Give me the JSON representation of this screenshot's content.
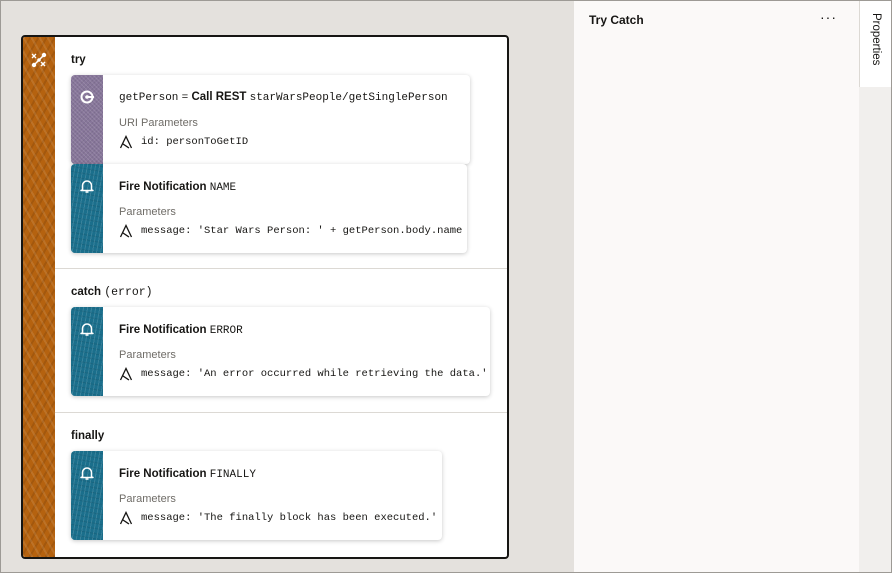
{
  "canvas": {
    "try_label": "try",
    "catch_label": "catch",
    "catch_param": "(error)",
    "finally_label": "finally"
  },
  "cards": {
    "rest": {
      "var": "getPerson",
      "eq": "=",
      "action": "Call REST",
      "endpoint": "starWarsPeople/getSinglePerson",
      "sub": "URI Parameters",
      "param": "id: personToGetID"
    },
    "notify_name": {
      "title": "Fire Notification",
      "type": "NAME",
      "sub": "Parameters",
      "param": "message: 'Star Wars Person: ' + getPerson.body.name"
    },
    "notify_error": {
      "title": "Fire Notification",
      "type": "ERROR",
      "sub": "Parameters",
      "param": "message: 'An error occurred while retrieving the data.'"
    },
    "notify_finally": {
      "title": "Fire Notification",
      "type": "FINALLY",
      "sub": "Parameters",
      "param": "message: 'The finally block has been executed.'"
    }
  },
  "panel": {
    "title": "Try Catch",
    "more_icon": "more-options-icon",
    "more_glyph": "···"
  },
  "rail": {
    "tab_label": "Properties"
  },
  "colors": {
    "trycatch_accent": "#b5620f",
    "notification_accent": "#1b6f8c",
    "rest_accent": "#87769a"
  }
}
